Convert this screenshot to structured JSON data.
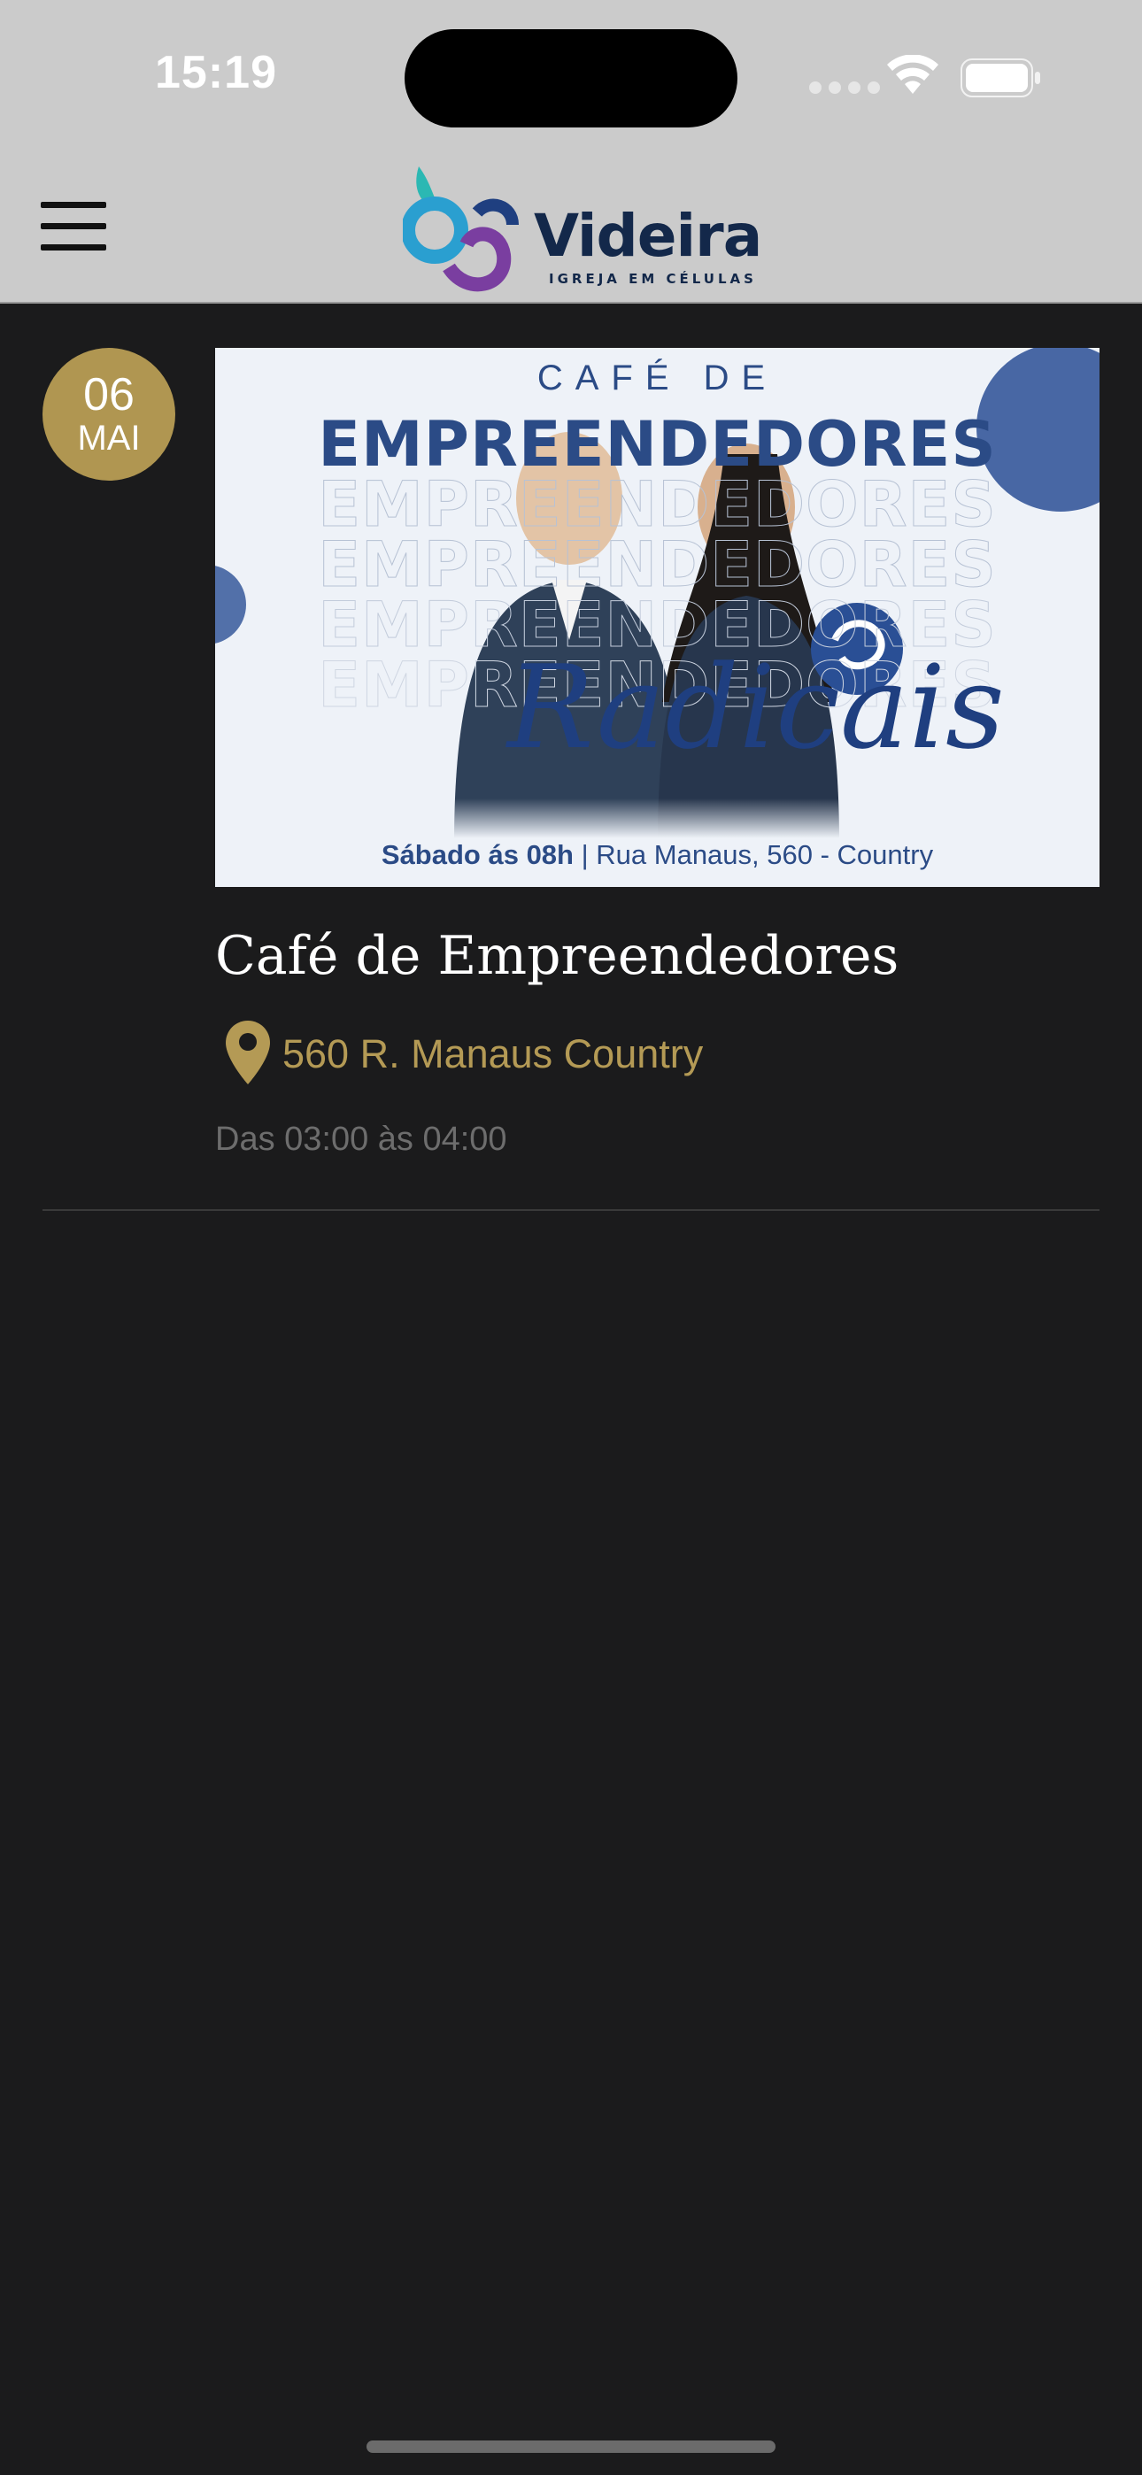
{
  "status_bar": {
    "time": "15:19",
    "icons": [
      "signal-icon",
      "wifi-icon",
      "battery-icon"
    ]
  },
  "header": {
    "menu_icon": "hamburger-menu-icon",
    "logo": {
      "word": "Videira",
      "tagline": "IGREJA EM CÉLULAS"
    }
  },
  "events": [
    {
      "date": {
        "day": "06",
        "month": "MAI"
      },
      "image": {
        "kicker": "CAFÉ DE",
        "headline": "EMPREENDEDORES",
        "script": "Radicais",
        "caption_bold": "Sábado ás 08h",
        "caption_rest": "| Rua Manaus, 560 - Country"
      },
      "title": "Café de Empreendedores",
      "location": "560 R. Manaus Country",
      "time": "Das 03:00 às 04:00"
    }
  ],
  "colors": {
    "background": "#1b1b1c",
    "header": "#cbcbcb",
    "accent_gold": "#b09651",
    "muted_text": "#6d6d6d"
  }
}
